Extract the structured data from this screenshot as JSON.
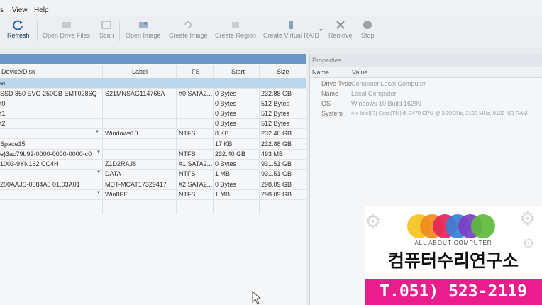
{
  "menu": [
    "s",
    "View",
    "Help"
  ],
  "toolbar": [
    {
      "label": "Refresh",
      "icon": "refresh-icon",
      "active": true
    },
    {
      "label": "Open Drive Files",
      "icon": "open-drive-files-icon"
    },
    {
      "label": "Scan",
      "icon": "scan-icon"
    },
    {
      "label": "Open Image",
      "icon": "open-image-icon"
    },
    {
      "label": "Create Image",
      "icon": "create-image-icon"
    },
    {
      "label": "Create Region",
      "icon": "create-region-icon"
    },
    {
      "label": "Create Virtual RAID",
      "icon": "create-virtual-raid-icon"
    },
    {
      "label": "Remove",
      "icon": "remove-icon"
    },
    {
      "label": "Stop",
      "icon": "stop-icon"
    }
  ],
  "columns": {
    "device": "Device/Disk",
    "label": "Label",
    "fs": "FS",
    "start": "Start",
    "size": "Size"
  },
  "rows": [
    {
      "device": "er",
      "label": "",
      "fs": "",
      "start": "",
      "size": ""
    },
    {
      "device": "SSD 850 EVO 250GB EMT0286Q",
      "label": "S21MNSAG114766A",
      "fs": "#0 SATA2...",
      "start": "0 Bytes",
      "size": "232.88 GB"
    },
    {
      "device": "t0",
      "label": "",
      "fs": "",
      "start": "0 Bytes",
      "size": "512 Bytes"
    },
    {
      "device": "t1",
      "label": "",
      "fs": "",
      "start": "0 Bytes",
      "size": "512 Bytes"
    },
    {
      "device": "t2",
      "label": "",
      "fs": "",
      "start": "0 Bytes",
      "size": "512 Bytes"
    },
    {
      "device": "",
      "label": "Windows10",
      "fs": "NTFS",
      "start": "8 KB",
      "size": "232.40 GB"
    },
    {
      "device": "Space15",
      "label": "",
      "fs": "",
      "start": "17 KB",
      "size": "232.88 GB"
    },
    {
      "device": "e}3ac79b92-0000-0000-0000-c0",
      "label": "",
      "fs": "NTFS",
      "start": "232.40 GB",
      "size": "493 MB"
    },
    {
      "device": "1003-9YN162 CC4H",
      "label": "Z1D2RAJ8",
      "fs": "#1 SATA2...",
      "start": "0 Bytes",
      "size": "931.51 GB"
    },
    {
      "device": "",
      "label": "DATA",
      "fs": "NTFS",
      "start": "1 MB",
      "size": "931.51 GB"
    },
    {
      "device": "200AAJS-0084A0 01.03A01",
      "label": "MDT-MCAT17329417",
      "fs": "#2 SATA2...",
      "start": "0 Bytes",
      "size": "298.09 GB"
    },
    {
      "device": "",
      "label": "Win8PE",
      "fs": "NTFS",
      "start": "1 MB",
      "size": "298.09 GB"
    }
  ],
  "properties": {
    "title": "Properties",
    "name_header": "Name",
    "value_header": "Value",
    "items": [
      {
        "name": "Drive Type",
        "value": "Computer,Local Computer"
      },
      {
        "name": "Name",
        "value": "Local Computer"
      },
      {
        "name": "OS",
        "value": "Windows 10 Build 16299"
      },
      {
        "name": "System",
        "value": "4 x Intel(R) Core(TM) i5-3470 CPU @ 3.20GHz, 3193 MHz, 8122 MB RAM"
      }
    ]
  },
  "ad": {
    "tagline": "ALL ABOUT COMPUTER",
    "name": "컴퓨터수리연구소",
    "phone": "T.051) 523-2119",
    "circle_colors": [
      "#f4c21f",
      "#f08a1c",
      "#e3245c",
      "#3a7fd6",
      "#7a3fc4",
      "#5dbb3b"
    ]
  }
}
